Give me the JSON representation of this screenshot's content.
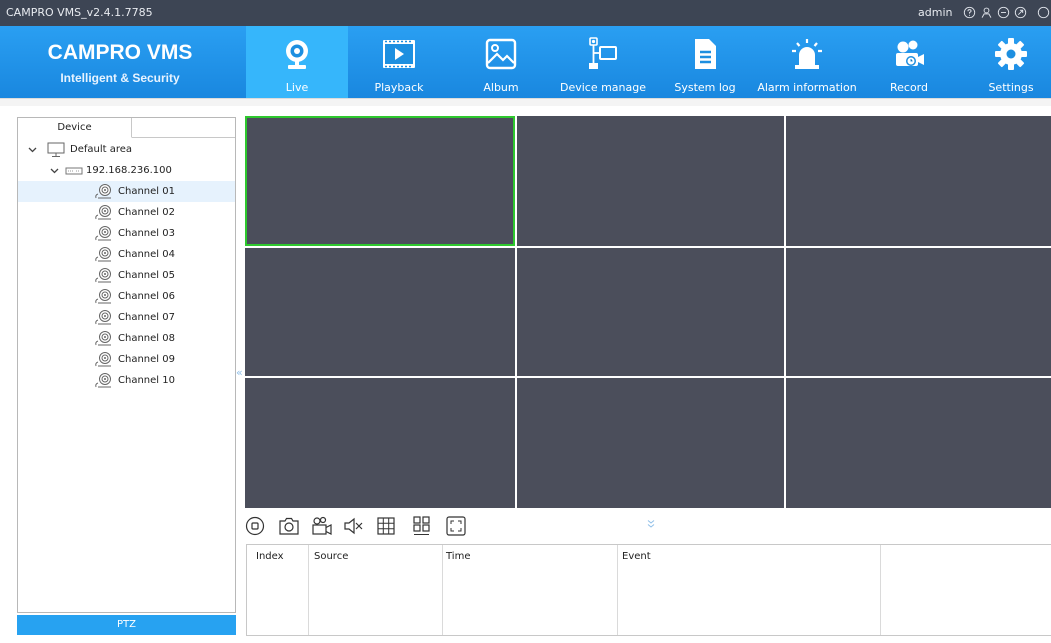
{
  "window": {
    "title": "CAMPRO VMS_v2.4.1.7785",
    "user": "admin",
    "controls": [
      "help-icon",
      "user-icon",
      "minimize-icon",
      "restore-icon",
      "close-icon"
    ]
  },
  "brand": {
    "name": "CAMPRO VMS",
    "tagline": "Intelligent & Security"
  },
  "nav": {
    "active": "Live",
    "items": [
      {
        "label": "Live",
        "icon": "webcam-icon"
      },
      {
        "label": "Playback",
        "icon": "film-play-icon"
      },
      {
        "label": "Album",
        "icon": "image-icon"
      },
      {
        "label": "Device manage",
        "icon": "network-device-icon"
      },
      {
        "label": "System log",
        "icon": "document-icon"
      },
      {
        "label": "Alarm information",
        "icon": "alarm-light-icon"
      },
      {
        "label": "Record",
        "icon": "video-record-icon"
      },
      {
        "label": "Settings",
        "icon": "gear-icon"
      }
    ]
  },
  "device_panel": {
    "tab": "Device",
    "area": "Default area",
    "device": "192.168.236.100",
    "channels": [
      "Channel 01",
      "Channel 02",
      "Channel 03",
      "Channel 04",
      "Channel 05",
      "Channel 06",
      "Channel 07",
      "Channel 08",
      "Channel 09",
      "Channel 10"
    ],
    "selected_channel": "Channel 01",
    "ptz_label": "PTZ",
    "collapse_glyph": "«"
  },
  "video_grid": {
    "layout": "3x3",
    "active_cell": 1
  },
  "toolbar": {
    "tools": [
      "stop-all-icon",
      "snapshot-icon",
      "record-icon",
      "mute-icon",
      "grid-layout-icon",
      "sequence-icon",
      "fullscreen-icon"
    ],
    "expand_glyph": "»"
  },
  "events": {
    "columns": [
      "Index",
      "Source",
      "Time",
      "Event"
    ],
    "rows": []
  },
  "colors": {
    "header_blue": "#1f93e8",
    "active_tab": "#36b6fb",
    "video_cell": "#4b4e5b",
    "active_cell_border": "#2ec82e",
    "ptz_bar": "#27a2f1"
  }
}
